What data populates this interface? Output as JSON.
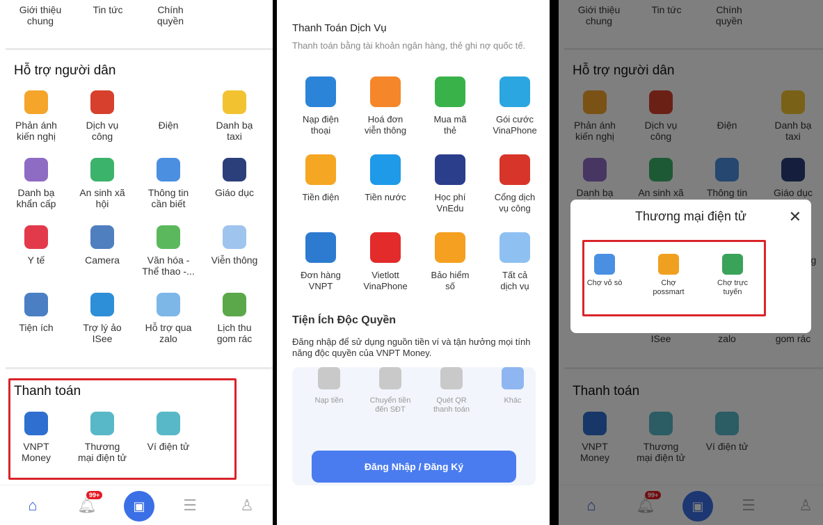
{
  "top_items": [
    "Giới thiệu\nchung",
    "Tin tức",
    "Chính\nquyền"
  ],
  "support": {
    "title": "Hỗ trợ người dân",
    "items": [
      {
        "label": "Phản ánh\nkiến nghị",
        "icon": "feedback-icon",
        "color": "#f4a52a"
      },
      {
        "label": "Dịch vụ\ncông",
        "icon": "public-service-icon",
        "color": "#d6402c"
      },
      {
        "label": "Điện",
        "icon": "evn-icon",
        "color": "#ffffff"
      },
      {
        "label": "Danh bạ\ntaxi",
        "icon": "taxi-icon",
        "color": "#f2c230"
      },
      {
        "label": "Danh bạ\nkhẩn cấp",
        "icon": "sos-icon",
        "color": "#8e6cc4"
      },
      {
        "label": "An sinh xã\nhội",
        "icon": "social-icon",
        "color": "#3cb36b"
      },
      {
        "label": "Thông tin\ncần biết",
        "icon": "info-icon",
        "color": "#4a8fe0"
      },
      {
        "label": "Giáo dục",
        "icon": "education-icon",
        "color": "#2b3f7a"
      },
      {
        "label": "Y tế",
        "icon": "health-icon",
        "color": "#e23a4a"
      },
      {
        "label": "Camera",
        "icon": "camera-icon",
        "color": "#4f7fbf"
      },
      {
        "label": "Văn hóa -\nThể thao -...",
        "icon": "culture-icon",
        "color": "#5cb85c"
      },
      {
        "label": "Viễn thông",
        "icon": "telecom-icon",
        "color": "#9fc4ee"
      },
      {
        "label": "Tiện ích",
        "icon": "utility-icon",
        "color": "#4a7fc4"
      },
      {
        "label": "Trợ lý ảo\nISee",
        "icon": "assistant-icon",
        "color": "#2d8fd8"
      },
      {
        "label": "Hỗ trợ qua\nzalo",
        "icon": "zalo-icon",
        "color": "#7db7e8"
      },
      {
        "label": "Lịch thu\ngom rác",
        "icon": "garbage-icon",
        "color": "#5aa84a"
      }
    ]
  },
  "payment": {
    "title": "Thanh toán",
    "items": [
      {
        "label": "VNPT\nMoney",
        "icon": "vnpt-money-icon",
        "color": "#2f6fd0"
      },
      {
        "label": "Thương\nmại điện tử",
        "icon": "ecommerce-icon",
        "color": "#58b8c8"
      },
      {
        "label": "Ví điện tử",
        "icon": "wallet-icon",
        "color": "#58b8c8"
      }
    ]
  },
  "nav": {
    "badge": "99+"
  },
  "service": {
    "title": "Thanh Toán Dịch Vụ",
    "subtitle": "Thanh toán bằng tài khoản ngân hàng, thẻ ghi nợ quốc tế.",
    "items": [
      {
        "label": "Nạp điện\nthoại",
        "icon": "phone-topup-icon",
        "color": "#2c84d8"
      },
      {
        "label": "Hoá đơn\nviễn thông",
        "icon": "telecom-bill-icon",
        "color": "#f5862a"
      },
      {
        "label": "Mua mã\nthẻ",
        "icon": "card-code-icon",
        "color": "#3ab24a"
      },
      {
        "label": "Gói cước\nVinaPhone",
        "icon": "vinaphone-icon",
        "color": "#2ba6e0"
      },
      {
        "label": "Tiền điện",
        "icon": "electricity-icon",
        "color": "#f5a623"
      },
      {
        "label": "Tiền nước",
        "icon": "water-icon",
        "color": "#1e9ae8"
      },
      {
        "label": "Học phí\nVnEdu",
        "icon": "vnedu-icon",
        "color": "#2a3e8c"
      },
      {
        "label": "Cổng dịch\nvụ công",
        "icon": "public-portal-icon",
        "color": "#d7352a"
      },
      {
        "label": "Đơn hàng\nVNPT",
        "icon": "vnpt-order-icon",
        "color": "#2c7bd0"
      },
      {
        "label": "Vietlott\nVinaPhone",
        "icon": "vietlott-icon",
        "color": "#e32b2b"
      },
      {
        "label": "Bảo hiểm\nsố",
        "icon": "insurance-icon",
        "color": "#f5a020"
      },
      {
        "label": "Tất cả\ndịch vụ",
        "icon": "more-icon",
        "color": "#8fc0f2"
      }
    ]
  },
  "exclusive": {
    "title": "Tiện Ích Độc Quyền",
    "subtitle": "Đăng nhập để sử dụng nguồn tiền ví và tận hưởng mọi tính năng độc quyền của VNPT Money.",
    "items": [
      {
        "label": "Nạp tiền",
        "icon": "deposit-icon",
        "color": "#c9c9c9"
      },
      {
        "label": "Chuyển tiền\nđến SĐT",
        "icon": "transfer-icon",
        "color": "#c9c9c9"
      },
      {
        "label": "Quét QR\nthanh toán",
        "icon": "qr-scan-icon",
        "color": "#c9c9c9"
      },
      {
        "label": "Khác",
        "icon": "more-icon",
        "color": "#8fb6f0"
      }
    ],
    "login_label": "Đăng Nhập / Đăng Ký"
  },
  "modal": {
    "title": "Thương mại điện tử",
    "items": [
      {
        "label": "Chợ vỏ sò",
        "icon": "cho-vo-so-icon",
        "color": "#4a90e2"
      },
      {
        "label": "Chợ\npossmart",
        "icon": "possmart-icon",
        "color": "#f0a020"
      },
      {
        "label": "Chợ trực\ntuyến",
        "icon": "online-market-icon",
        "color": "#3aa35a"
      }
    ]
  }
}
